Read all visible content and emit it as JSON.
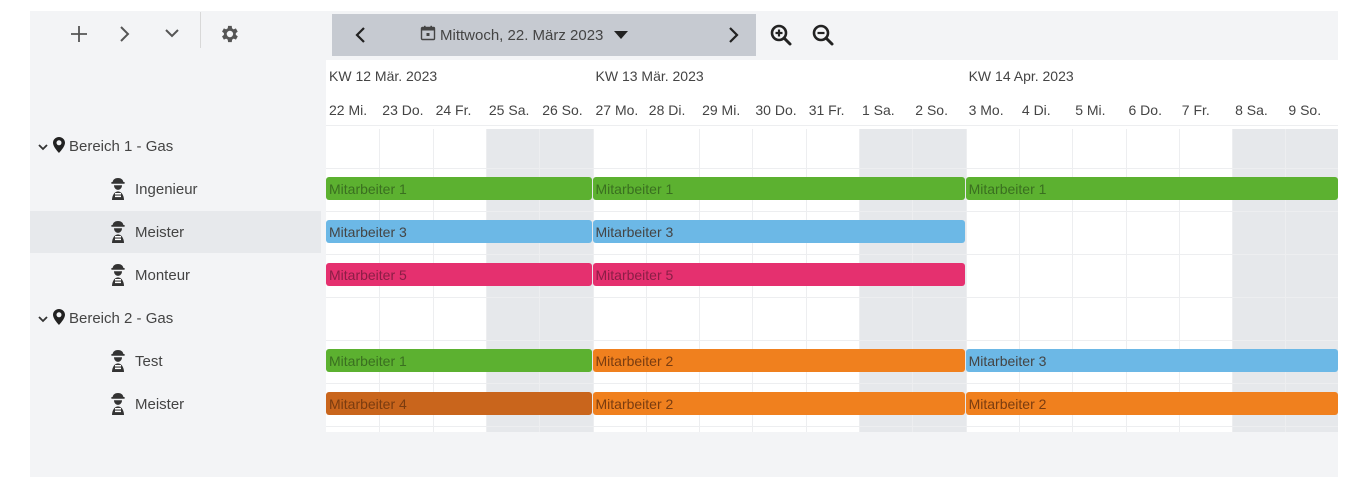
{
  "toolbar": {
    "icons": [
      "plus-icon",
      "chevron-right-icon",
      "chevron-down-icon",
      "gear-icon"
    ]
  },
  "datebar": {
    "current_date": "Mittwoch, 22. März 2023",
    "icons": [
      "chevron-left-icon",
      "calendar-icon",
      "caret-down-icon",
      "chevron-right-icon",
      "zoom-in-icon",
      "zoom-out-icon"
    ]
  },
  "weeks": [
    "KW 12 Mär. 2023",
    "KW 13 Mär. 2023",
    "KW 14 Apr. 2023"
  ],
  "days": [
    "22 Mi.",
    "23 Do.",
    "24 Fr.",
    "25 Sa.",
    "26 So.",
    "27 Mo.",
    "28 Di.",
    "29 Mi.",
    "30 Do.",
    "31 Fr.",
    "1 Sa.",
    "2 So.",
    "3 Mo.",
    "4 Di.",
    "5 Mi.",
    "6 Do.",
    "7 Fr.",
    "8 Sa.",
    "9 So."
  ],
  "resources": [
    {
      "type": "group",
      "label": "Bereich 1 - Gas"
    },
    {
      "type": "resource",
      "label": "Ingenieur"
    },
    {
      "type": "resource",
      "label": "Meister",
      "highlighted": true
    },
    {
      "type": "resource",
      "label": "Monteur"
    },
    {
      "type": "group",
      "label": "Bereich 2 - Gas"
    },
    {
      "type": "resource",
      "label": "Test"
    },
    {
      "type": "resource",
      "label": "Meister"
    }
  ],
  "colors": {
    "green": "#5cb130",
    "blue": "#6cb8e6",
    "pink": "#e5306f",
    "orange": "#f0801e",
    "dark_orange": "#c9651c"
  },
  "bars": [
    {
      "row": 1,
      "label": "Mitarbeiter 1",
      "start": 0,
      "end": 5,
      "color": "green"
    },
    {
      "row": 1,
      "label": "Mitarbeiter 1",
      "start": 5,
      "end": 12,
      "color": "green"
    },
    {
      "row": 1,
      "label": "Mitarbeiter 1",
      "start": 12,
      "end": 19,
      "color": "green"
    },
    {
      "row": 2,
      "label": "Mitarbeiter 3",
      "start": 0,
      "end": 5,
      "color": "blue"
    },
    {
      "row": 2,
      "label": "Mitarbeiter 3",
      "start": 5,
      "end": 12,
      "color": "blue"
    },
    {
      "row": 3,
      "label": "Mitarbeiter 5",
      "start": 0,
      "end": 5,
      "color": "pink"
    },
    {
      "row": 3,
      "label": "Mitarbeiter 5",
      "start": 5,
      "end": 12,
      "color": "pink"
    },
    {
      "row": 5,
      "label": "Mitarbeiter 1",
      "start": 0,
      "end": 5,
      "color": "green"
    },
    {
      "row": 5,
      "label": "Mitarbeiter 2",
      "start": 5,
      "end": 12,
      "color": "orange"
    },
    {
      "row": 5,
      "label": "Mitarbeiter 3",
      "start": 12,
      "end": 19,
      "color": "blue"
    },
    {
      "row": 6,
      "label": "Mitarbeiter 4",
      "start": 0,
      "end": 5,
      "color": "dark_orange"
    },
    {
      "row": 6,
      "label": "Mitarbeiter 2",
      "start": 5,
      "end": 12,
      "color": "orange"
    },
    {
      "row": 6,
      "label": "Mitarbeiter 2",
      "start": 12,
      "end": 19,
      "color": "orange"
    }
  ]
}
